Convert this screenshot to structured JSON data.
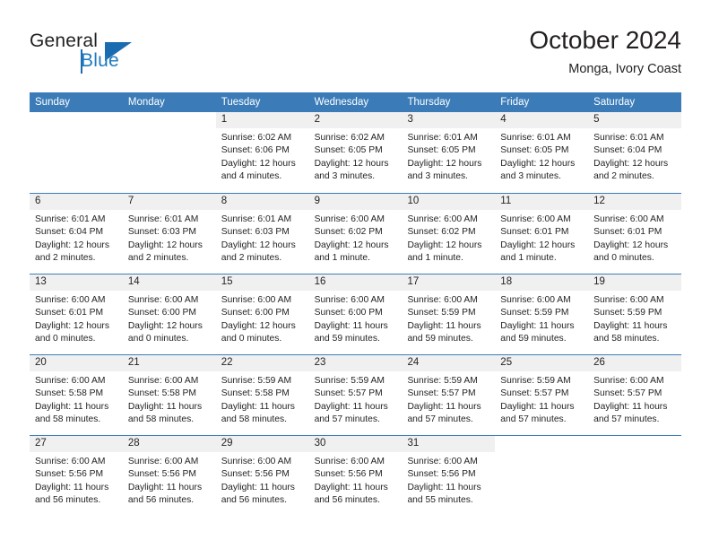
{
  "brand": {
    "word_general": "General",
    "word_blue": "Blue",
    "logo_icon": "triangle-logo-icon"
  },
  "header": {
    "title": "October 2024",
    "subtitle": "Monga, Ivory Coast"
  },
  "colors": {
    "header_blue": "#3b7cb8",
    "brand_blue": "#1f7ac0",
    "num_band_gray": "#f0f0f0",
    "text": "#231f20"
  },
  "weekdays": [
    "Sunday",
    "Monday",
    "Tuesday",
    "Wednesday",
    "Thursday",
    "Friday",
    "Saturday"
  ],
  "weeks": [
    [
      {
        "day": "",
        "lines": []
      },
      {
        "day": "",
        "lines": []
      },
      {
        "day": "1",
        "lines": [
          "Sunrise: 6:02 AM",
          "Sunset: 6:06 PM",
          "Daylight: 12 hours",
          "and 4 minutes."
        ]
      },
      {
        "day": "2",
        "lines": [
          "Sunrise: 6:02 AM",
          "Sunset: 6:05 PM",
          "Daylight: 12 hours",
          "and 3 minutes."
        ]
      },
      {
        "day": "3",
        "lines": [
          "Sunrise: 6:01 AM",
          "Sunset: 6:05 PM",
          "Daylight: 12 hours",
          "and 3 minutes."
        ]
      },
      {
        "day": "4",
        "lines": [
          "Sunrise: 6:01 AM",
          "Sunset: 6:05 PM",
          "Daylight: 12 hours",
          "and 3 minutes."
        ]
      },
      {
        "day": "5",
        "lines": [
          "Sunrise: 6:01 AM",
          "Sunset: 6:04 PM",
          "Daylight: 12 hours",
          "and 2 minutes."
        ]
      }
    ],
    [
      {
        "day": "6",
        "lines": [
          "Sunrise: 6:01 AM",
          "Sunset: 6:04 PM",
          "Daylight: 12 hours",
          "and 2 minutes."
        ]
      },
      {
        "day": "7",
        "lines": [
          "Sunrise: 6:01 AM",
          "Sunset: 6:03 PM",
          "Daylight: 12 hours",
          "and 2 minutes."
        ]
      },
      {
        "day": "8",
        "lines": [
          "Sunrise: 6:01 AM",
          "Sunset: 6:03 PM",
          "Daylight: 12 hours",
          "and 2 minutes."
        ]
      },
      {
        "day": "9",
        "lines": [
          "Sunrise: 6:00 AM",
          "Sunset: 6:02 PM",
          "Daylight: 12 hours",
          "and 1 minute."
        ]
      },
      {
        "day": "10",
        "lines": [
          "Sunrise: 6:00 AM",
          "Sunset: 6:02 PM",
          "Daylight: 12 hours",
          "and 1 minute."
        ]
      },
      {
        "day": "11",
        "lines": [
          "Sunrise: 6:00 AM",
          "Sunset: 6:01 PM",
          "Daylight: 12 hours",
          "and 1 minute."
        ]
      },
      {
        "day": "12",
        "lines": [
          "Sunrise: 6:00 AM",
          "Sunset: 6:01 PM",
          "Daylight: 12 hours",
          "and 0 minutes."
        ]
      }
    ],
    [
      {
        "day": "13",
        "lines": [
          "Sunrise: 6:00 AM",
          "Sunset: 6:01 PM",
          "Daylight: 12 hours",
          "and 0 minutes."
        ]
      },
      {
        "day": "14",
        "lines": [
          "Sunrise: 6:00 AM",
          "Sunset: 6:00 PM",
          "Daylight: 12 hours",
          "and 0 minutes."
        ]
      },
      {
        "day": "15",
        "lines": [
          "Sunrise: 6:00 AM",
          "Sunset: 6:00 PM",
          "Daylight: 12 hours",
          "and 0 minutes."
        ]
      },
      {
        "day": "16",
        "lines": [
          "Sunrise: 6:00 AM",
          "Sunset: 6:00 PM",
          "Daylight: 11 hours",
          "and 59 minutes."
        ]
      },
      {
        "day": "17",
        "lines": [
          "Sunrise: 6:00 AM",
          "Sunset: 5:59 PM",
          "Daylight: 11 hours",
          "and 59 minutes."
        ]
      },
      {
        "day": "18",
        "lines": [
          "Sunrise: 6:00 AM",
          "Sunset: 5:59 PM",
          "Daylight: 11 hours",
          "and 59 minutes."
        ]
      },
      {
        "day": "19",
        "lines": [
          "Sunrise: 6:00 AM",
          "Sunset: 5:59 PM",
          "Daylight: 11 hours",
          "and 58 minutes."
        ]
      }
    ],
    [
      {
        "day": "20",
        "lines": [
          "Sunrise: 6:00 AM",
          "Sunset: 5:58 PM",
          "Daylight: 11 hours",
          "and 58 minutes."
        ]
      },
      {
        "day": "21",
        "lines": [
          "Sunrise: 6:00 AM",
          "Sunset: 5:58 PM",
          "Daylight: 11 hours",
          "and 58 minutes."
        ]
      },
      {
        "day": "22",
        "lines": [
          "Sunrise: 5:59 AM",
          "Sunset: 5:58 PM",
          "Daylight: 11 hours",
          "and 58 minutes."
        ]
      },
      {
        "day": "23",
        "lines": [
          "Sunrise: 5:59 AM",
          "Sunset: 5:57 PM",
          "Daylight: 11 hours",
          "and 57 minutes."
        ]
      },
      {
        "day": "24",
        "lines": [
          "Sunrise: 5:59 AM",
          "Sunset: 5:57 PM",
          "Daylight: 11 hours",
          "and 57 minutes."
        ]
      },
      {
        "day": "25",
        "lines": [
          "Sunrise: 5:59 AM",
          "Sunset: 5:57 PM",
          "Daylight: 11 hours",
          "and 57 minutes."
        ]
      },
      {
        "day": "26",
        "lines": [
          "Sunrise: 6:00 AM",
          "Sunset: 5:57 PM",
          "Daylight: 11 hours",
          "and 57 minutes."
        ]
      }
    ],
    [
      {
        "day": "27",
        "lines": [
          "Sunrise: 6:00 AM",
          "Sunset: 5:56 PM",
          "Daylight: 11 hours",
          "and 56 minutes."
        ]
      },
      {
        "day": "28",
        "lines": [
          "Sunrise: 6:00 AM",
          "Sunset: 5:56 PM",
          "Daylight: 11 hours",
          "and 56 minutes."
        ]
      },
      {
        "day": "29",
        "lines": [
          "Sunrise: 6:00 AM",
          "Sunset: 5:56 PM",
          "Daylight: 11 hours",
          "and 56 minutes."
        ]
      },
      {
        "day": "30",
        "lines": [
          "Sunrise: 6:00 AM",
          "Sunset: 5:56 PM",
          "Daylight: 11 hours",
          "and 56 minutes."
        ]
      },
      {
        "day": "31",
        "lines": [
          "Sunrise: 6:00 AM",
          "Sunset: 5:56 PM",
          "Daylight: 11 hours",
          "and 55 minutes."
        ]
      },
      {
        "day": "",
        "lines": []
      },
      {
        "day": "",
        "lines": []
      }
    ]
  ]
}
